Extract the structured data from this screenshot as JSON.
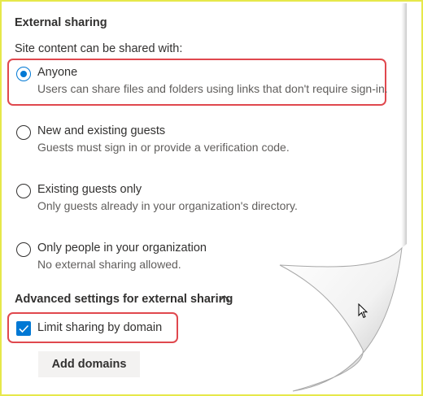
{
  "external_sharing": {
    "title": "External sharing",
    "subtitle": "Site content can be shared with:",
    "options": [
      {
        "label": "Anyone",
        "description": "Users can share files and folders using links that don't require sign-in.",
        "selected": true
      },
      {
        "label": "New and existing guests",
        "description": "Guests must sign in or provide a verification code.",
        "selected": false
      },
      {
        "label": "Existing guests only",
        "description": "Only guests already in your organization's directory.",
        "selected": false
      },
      {
        "label": "Only people in your organization",
        "description": "No external sharing allowed.",
        "selected": false
      }
    ]
  },
  "advanced": {
    "title": "Advanced settings for external sharing",
    "chevron_icon": "chevron-up-icon",
    "limit_by_domain": {
      "label": "Limit sharing by domain",
      "checked": true
    },
    "add_domains_label": "Add domains"
  },
  "colors": {
    "accent": "#0078d4",
    "highlight_outline": "#e0484e",
    "frame_border": "#e6e84a"
  }
}
